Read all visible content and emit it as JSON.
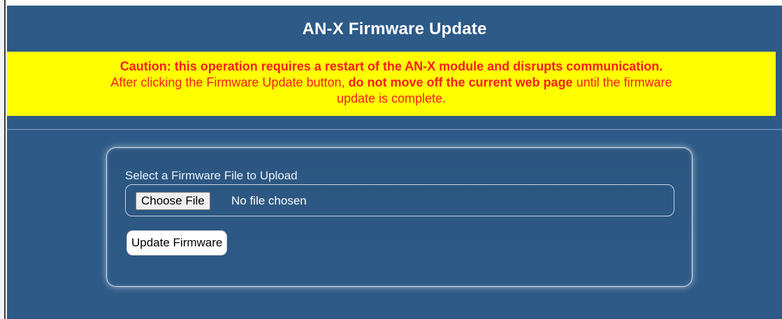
{
  "header": {
    "title": "AN-X Firmware Update"
  },
  "caution": {
    "line1": "Caution: this operation requires a restart of the AN-X module and disrupts communication.",
    "line2_prefix": "After clicking the Firmware Update button, ",
    "line2_bold": "do not move off the current web page",
    "line2_suffix": " until the firmware",
    "line3": "update is complete."
  },
  "upload": {
    "label": "Select a Firmware File to Upload",
    "choose_button": "Choose File",
    "file_status": "No file chosen",
    "update_button": "Update Firmware"
  },
  "colors": {
    "panel_background": "#2d5a87",
    "caution_background": "#ffff00",
    "caution_text": "#ff1c1c",
    "title_text": "#ffffff"
  }
}
